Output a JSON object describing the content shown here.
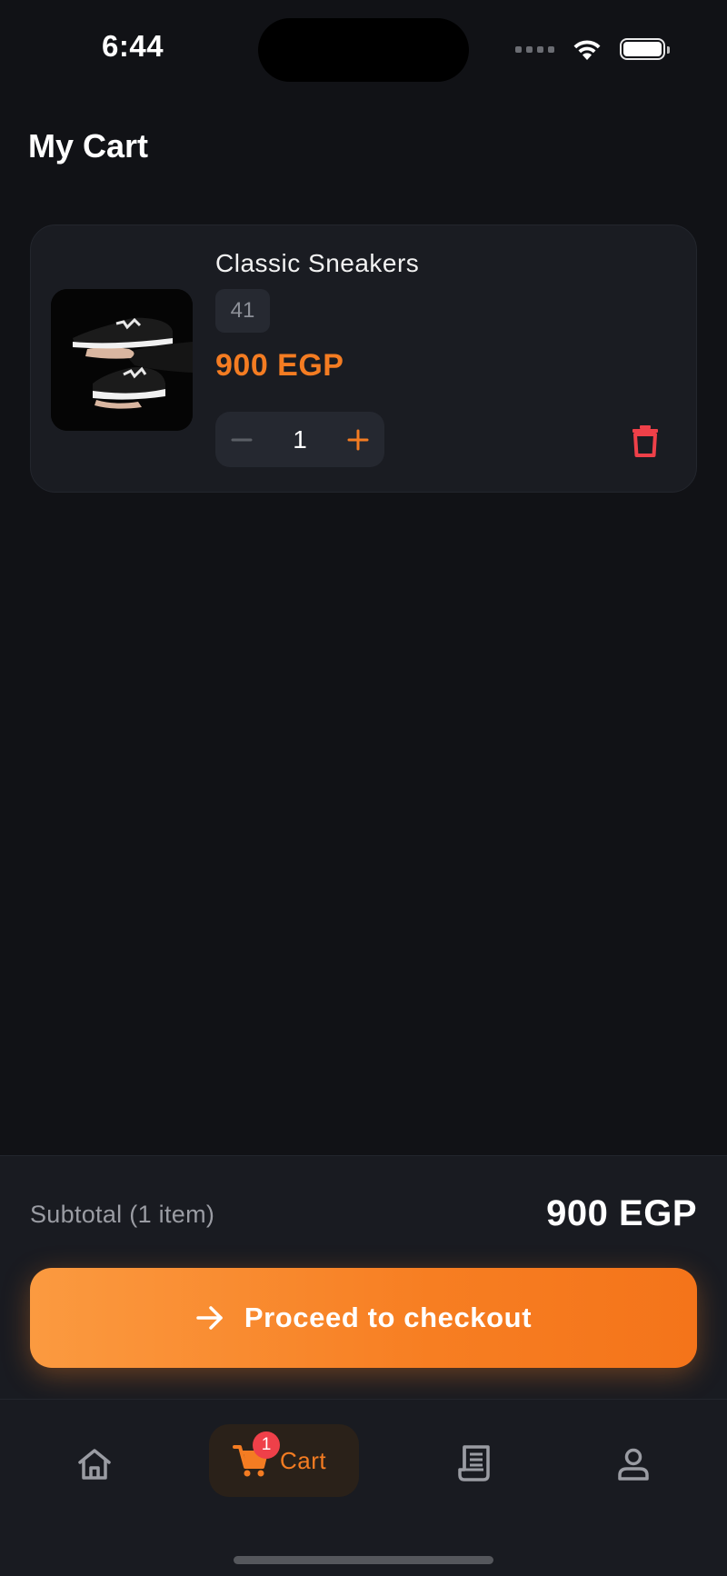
{
  "status_bar": {
    "time": "6:44"
  },
  "header": {
    "title": "My Cart"
  },
  "cart": {
    "items": [
      {
        "name": "Classic Sneakers",
        "size": "41",
        "price": "900 EGP",
        "quantity": "1",
        "image_icon": "sneakers-product-photo"
      }
    ]
  },
  "summary": {
    "subtotal_label": "Subtotal (1 item)",
    "subtotal_value": "900 EGP",
    "checkout_label": "Proceed to checkout"
  },
  "nav": {
    "cart_label": "Cart",
    "cart_badge": "1",
    "items": [
      "home-icon",
      "cart-icon",
      "orders-icon",
      "profile-icon"
    ]
  },
  "colors": {
    "background": "#111216",
    "card": "#1a1c22",
    "accent": "#f47c22",
    "danger": "#ef4049"
  }
}
